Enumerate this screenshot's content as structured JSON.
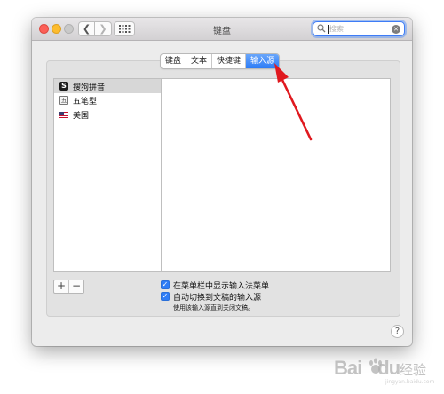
{
  "window": {
    "title": "键盘",
    "search": {
      "placeholder": "搜索"
    }
  },
  "tabs": [
    {
      "label": "键盘",
      "active": false
    },
    {
      "label": "文本",
      "active": false
    },
    {
      "label": "快捷键",
      "active": false
    },
    {
      "label": "输入源",
      "active": true
    }
  ],
  "input_sources": [
    {
      "label": "搜狗拼音",
      "icon": "sogou-icon",
      "selected": true
    },
    {
      "label": "五笔型",
      "icon": "wubi-icon",
      "selected": false
    },
    {
      "label": "美国",
      "icon": "us-flag-icon",
      "selected": false
    }
  ],
  "list_controls": {
    "add": "+",
    "remove": "−"
  },
  "options": {
    "show_menu": {
      "label": "在菜单栏中显示输入法菜单",
      "checked": true
    },
    "auto_switch": {
      "label": "自动切换到文稿的输入源",
      "checked": true
    },
    "hint": "使用该输入源直到关闭文稿。"
  },
  "help": "?",
  "watermark": {
    "logo_left": "Bai",
    "logo_right": "du",
    "suffix": "经验",
    "url": "jingyan.baidu.com"
  },
  "colors": {
    "accent": "#2d7cf6",
    "annotation_arrow": "#e0191f"
  }
}
